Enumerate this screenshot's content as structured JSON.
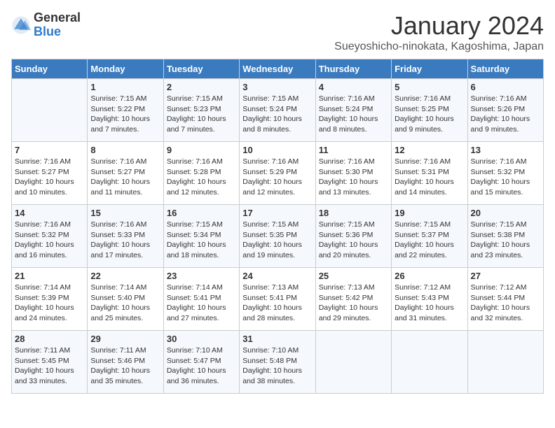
{
  "header": {
    "logo_general": "General",
    "logo_blue": "Blue",
    "month_title": "January 2024",
    "location": "Sueyoshicho-ninokata, Kagoshima, Japan"
  },
  "days_of_week": [
    "Sunday",
    "Monday",
    "Tuesday",
    "Wednesday",
    "Thursday",
    "Friday",
    "Saturday"
  ],
  "weeks": [
    [
      {
        "day": "",
        "content": ""
      },
      {
        "day": "1",
        "content": "Sunrise: 7:15 AM\nSunset: 5:22 PM\nDaylight: 10 hours\nand 7 minutes."
      },
      {
        "day": "2",
        "content": "Sunrise: 7:15 AM\nSunset: 5:23 PM\nDaylight: 10 hours\nand 7 minutes."
      },
      {
        "day": "3",
        "content": "Sunrise: 7:15 AM\nSunset: 5:24 PM\nDaylight: 10 hours\nand 8 minutes."
      },
      {
        "day": "4",
        "content": "Sunrise: 7:16 AM\nSunset: 5:24 PM\nDaylight: 10 hours\nand 8 minutes."
      },
      {
        "day": "5",
        "content": "Sunrise: 7:16 AM\nSunset: 5:25 PM\nDaylight: 10 hours\nand 9 minutes."
      },
      {
        "day": "6",
        "content": "Sunrise: 7:16 AM\nSunset: 5:26 PM\nDaylight: 10 hours\nand 9 minutes."
      }
    ],
    [
      {
        "day": "7",
        "content": "Sunrise: 7:16 AM\nSunset: 5:27 PM\nDaylight: 10 hours\nand 10 minutes."
      },
      {
        "day": "8",
        "content": "Sunrise: 7:16 AM\nSunset: 5:27 PM\nDaylight: 10 hours\nand 11 minutes."
      },
      {
        "day": "9",
        "content": "Sunrise: 7:16 AM\nSunset: 5:28 PM\nDaylight: 10 hours\nand 12 minutes."
      },
      {
        "day": "10",
        "content": "Sunrise: 7:16 AM\nSunset: 5:29 PM\nDaylight: 10 hours\nand 12 minutes."
      },
      {
        "day": "11",
        "content": "Sunrise: 7:16 AM\nSunset: 5:30 PM\nDaylight: 10 hours\nand 13 minutes."
      },
      {
        "day": "12",
        "content": "Sunrise: 7:16 AM\nSunset: 5:31 PM\nDaylight: 10 hours\nand 14 minutes."
      },
      {
        "day": "13",
        "content": "Sunrise: 7:16 AM\nSunset: 5:32 PM\nDaylight: 10 hours\nand 15 minutes."
      }
    ],
    [
      {
        "day": "14",
        "content": "Sunrise: 7:16 AM\nSunset: 5:32 PM\nDaylight: 10 hours\nand 16 minutes."
      },
      {
        "day": "15",
        "content": "Sunrise: 7:16 AM\nSunset: 5:33 PM\nDaylight: 10 hours\nand 17 minutes."
      },
      {
        "day": "16",
        "content": "Sunrise: 7:15 AM\nSunset: 5:34 PM\nDaylight: 10 hours\nand 18 minutes."
      },
      {
        "day": "17",
        "content": "Sunrise: 7:15 AM\nSunset: 5:35 PM\nDaylight: 10 hours\nand 19 minutes."
      },
      {
        "day": "18",
        "content": "Sunrise: 7:15 AM\nSunset: 5:36 PM\nDaylight: 10 hours\nand 20 minutes."
      },
      {
        "day": "19",
        "content": "Sunrise: 7:15 AM\nSunset: 5:37 PM\nDaylight: 10 hours\nand 22 minutes."
      },
      {
        "day": "20",
        "content": "Sunrise: 7:15 AM\nSunset: 5:38 PM\nDaylight: 10 hours\nand 23 minutes."
      }
    ],
    [
      {
        "day": "21",
        "content": "Sunrise: 7:14 AM\nSunset: 5:39 PM\nDaylight: 10 hours\nand 24 minutes."
      },
      {
        "day": "22",
        "content": "Sunrise: 7:14 AM\nSunset: 5:40 PM\nDaylight: 10 hours\nand 25 minutes."
      },
      {
        "day": "23",
        "content": "Sunrise: 7:14 AM\nSunset: 5:41 PM\nDaylight: 10 hours\nand 27 minutes."
      },
      {
        "day": "24",
        "content": "Sunrise: 7:13 AM\nSunset: 5:41 PM\nDaylight: 10 hours\nand 28 minutes."
      },
      {
        "day": "25",
        "content": "Sunrise: 7:13 AM\nSunset: 5:42 PM\nDaylight: 10 hours\nand 29 minutes."
      },
      {
        "day": "26",
        "content": "Sunrise: 7:12 AM\nSunset: 5:43 PM\nDaylight: 10 hours\nand 31 minutes."
      },
      {
        "day": "27",
        "content": "Sunrise: 7:12 AM\nSunset: 5:44 PM\nDaylight: 10 hours\nand 32 minutes."
      }
    ],
    [
      {
        "day": "28",
        "content": "Sunrise: 7:11 AM\nSunset: 5:45 PM\nDaylight: 10 hours\nand 33 minutes."
      },
      {
        "day": "29",
        "content": "Sunrise: 7:11 AM\nSunset: 5:46 PM\nDaylight: 10 hours\nand 35 minutes."
      },
      {
        "day": "30",
        "content": "Sunrise: 7:10 AM\nSunset: 5:47 PM\nDaylight: 10 hours\nand 36 minutes."
      },
      {
        "day": "31",
        "content": "Sunrise: 7:10 AM\nSunset: 5:48 PM\nDaylight: 10 hours\nand 38 minutes."
      },
      {
        "day": "",
        "content": ""
      },
      {
        "day": "",
        "content": ""
      },
      {
        "day": "",
        "content": ""
      }
    ]
  ]
}
